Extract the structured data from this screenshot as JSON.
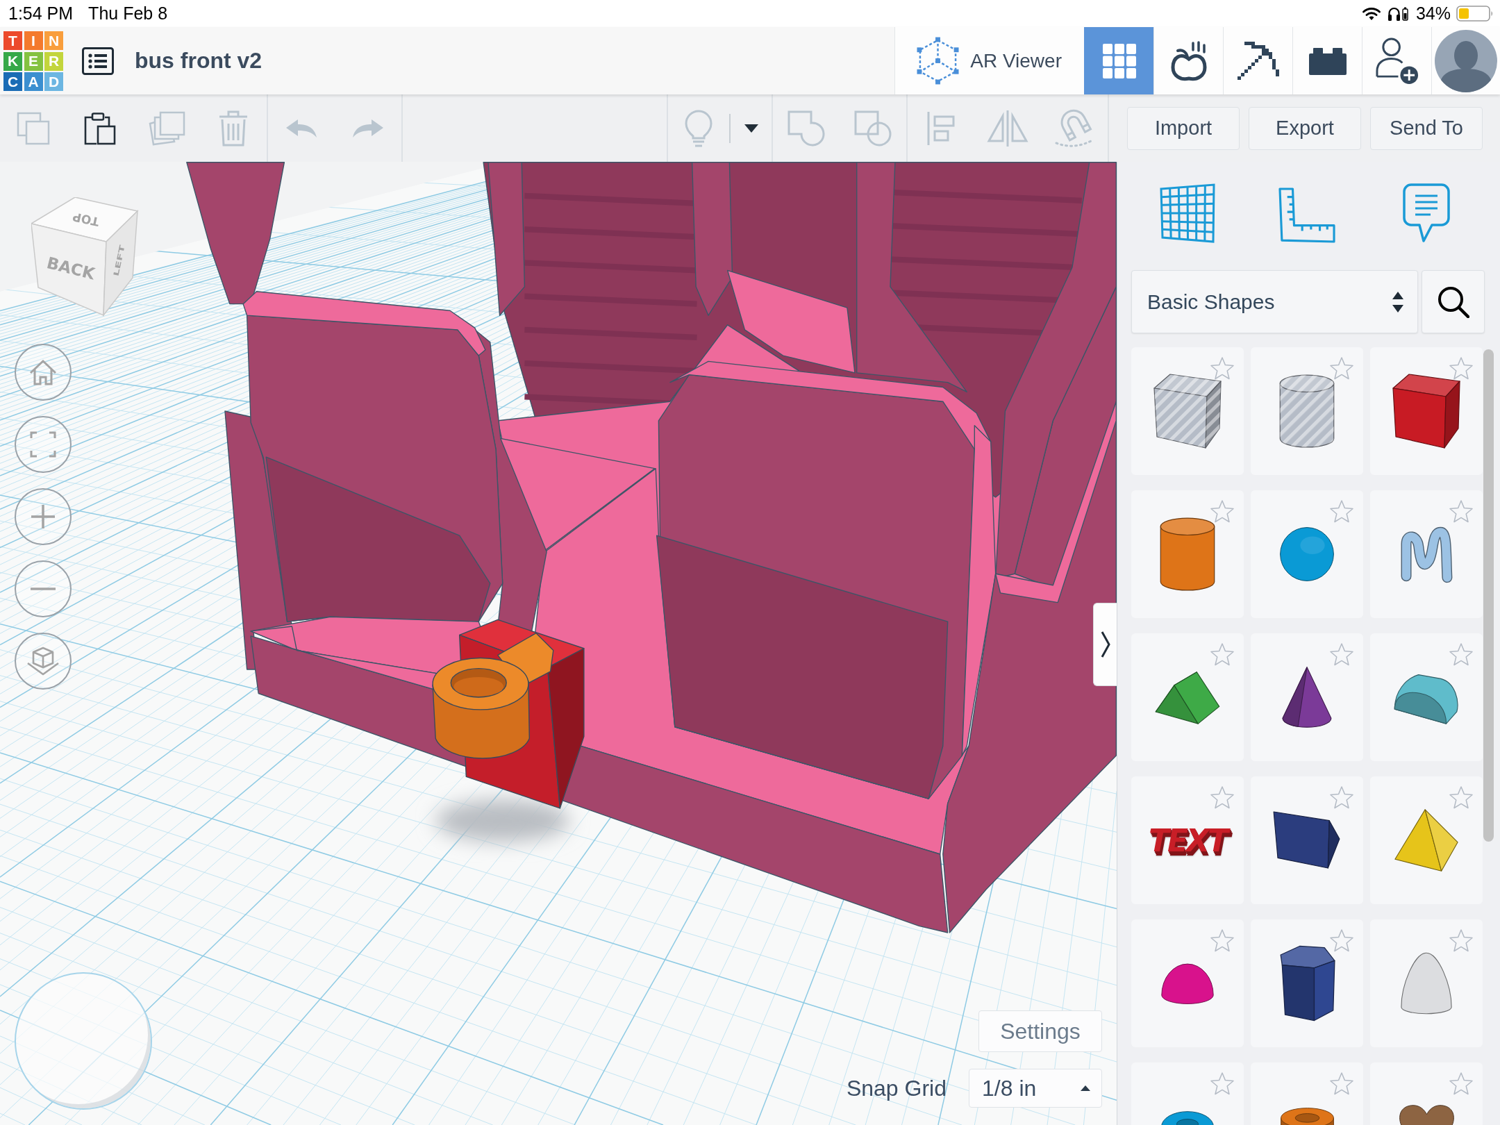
{
  "status_bar": {
    "time": "1:54 PM",
    "date": "Thu Feb 8",
    "battery_percent": "34%"
  },
  "header": {
    "logo": [
      {
        "letter": "T",
        "color": "#ec4a2c"
      },
      {
        "letter": "I",
        "color": "#f47a2d"
      },
      {
        "letter": "N",
        "color": "#f99e3c"
      },
      {
        "letter": "K",
        "color": "#36a848"
      },
      {
        "letter": "E",
        "color": "#84c241"
      },
      {
        "letter": "R",
        "color": "#c3d53c"
      },
      {
        "letter": "C",
        "color": "#1a6cb5"
      },
      {
        "letter": "A",
        "color": "#3b8fd0"
      },
      {
        "letter": "D",
        "color": "#6cb6e2"
      }
    ],
    "title": "bus front v2",
    "ar_viewer": "AR Viewer",
    "modes": [
      {
        "kind": "design",
        "selected": true
      },
      {
        "kind": "sim",
        "selected": false
      },
      {
        "kind": "blocks",
        "selected": false
      },
      {
        "kind": "bricks",
        "selected": false
      }
    ]
  },
  "toolbar": {
    "edit_tools": [
      [
        {
          "kind": "copy",
          "disabled": true
        },
        {
          "kind": "paste",
          "disabled": false
        },
        {
          "kind": "duplicate",
          "disabled": true
        },
        {
          "kind": "delete",
          "disabled": true
        }
      ],
      [
        {
          "kind": "undo",
          "disabled": true
        },
        {
          "kind": "redo",
          "disabled": true
        }
      ]
    ],
    "view_tools": [
      [
        {
          "kind": "show-all",
          "disabled": true
        },
        {
          "kind": "more",
          "disabled": false
        }
      ],
      [
        {
          "kind": "group",
          "disabled": true
        },
        {
          "kind": "ungroup",
          "disabled": true
        }
      ],
      [
        {
          "kind": "align",
          "disabled": true
        },
        {
          "kind": "mirror",
          "disabled": true
        },
        {
          "kind": "cruise",
          "disabled": true
        }
      ]
    ],
    "buttons": [
      "Import",
      "Export",
      "Send To"
    ]
  },
  "viewport": {
    "view_cube": [
      "TOP",
      "BACK",
      "LEFT"
    ],
    "settings": "Settings",
    "snap_grid": {
      "label": "Snap Grid",
      "value": "1/8 in"
    }
  },
  "library": {
    "category": "Basic Shapes",
    "shapes": [
      {
        "kind": "box-hole",
        "color": "#b5bcc7"
      },
      {
        "kind": "cylinder-hole",
        "color": "#b5bcc7"
      },
      {
        "kind": "box",
        "color": "#c81b24"
      },
      {
        "kind": "cylinder",
        "color": "#de7418"
      },
      {
        "kind": "sphere",
        "color": "#0a9ad5"
      },
      {
        "kind": "scribble",
        "color": "#9cc2e4"
      },
      {
        "kind": "roof",
        "color": "#3eaa47"
      },
      {
        "kind": "cone",
        "color": "#7b3a98"
      },
      {
        "kind": "round-roof",
        "color": "#5fbccb"
      },
      {
        "kind": "text",
        "color": "#c81e27",
        "label": "TEXT"
      },
      {
        "kind": "wedge",
        "color": "#2b3d7e"
      },
      {
        "kind": "pyramid",
        "color": "#e6c41a"
      },
      {
        "kind": "half-sphere",
        "color": "#d8128c"
      },
      {
        "kind": "polygon",
        "color": "#2f4791"
      },
      {
        "kind": "paraboloid",
        "color": "#dcdde0"
      },
      {
        "kind": "torus",
        "color": "#0a9ad5"
      },
      {
        "kind": "tube",
        "color": "#de7418"
      },
      {
        "kind": "heart",
        "color": "#8d6442"
      }
    ]
  }
}
